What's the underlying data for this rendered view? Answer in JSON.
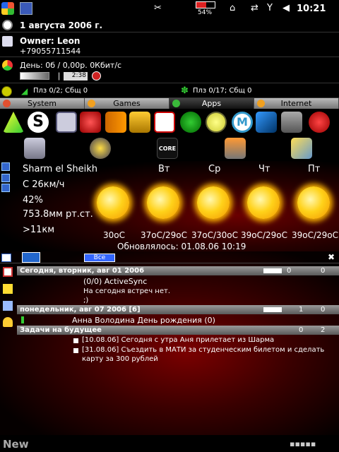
{
  "status": {
    "battery": "54%",
    "time": "10:21",
    "battery_level": 0.54
  },
  "date_row": {
    "text": "1 августа 2006 г."
  },
  "owner": {
    "name": "Owner: Leon",
    "phone": "+79055711544"
  },
  "traffic": {
    "text": "День: 0б / 0,00р. 0Кбит/с",
    "counter": "2:38"
  },
  "messages": {
    "left": "Плз 0/2; Сбщ 0",
    "right": "Плз 0/17; Сбщ 0"
  },
  "tabs": [
    {
      "label": "System",
      "dot": "#e05030"
    },
    {
      "label": "Games",
      "dot": "#f0a020"
    },
    {
      "label": "Apps",
      "dot": "#3aba3a"
    },
    {
      "label": "Internet",
      "dot": "#f0a020"
    }
  ],
  "apps_row2_label": "CORE",
  "weather": {
    "city": "Sharm el Sheikh",
    "wind": "С 26км/ч",
    "humidity": "42%",
    "pressure": "753.8мм рт.ст.",
    "visibility": ">11км",
    "days": [
      "Вт",
      "Ср",
      "Чт",
      "Пт"
    ],
    "temps": [
      "30oC",
      "37oC/29oC",
      "37oC/30oC",
      "39oC/29oC",
      "39oC/29oC"
    ],
    "updated": "Обновлялось: 01.08.06 10:19"
  },
  "agenda": {
    "filter": "Все",
    "today_header": "Сегодня, вторник, авг 01 2006",
    "today_counts": [
      "0",
      "0"
    ],
    "activesync": "(0/0) ActiveSync",
    "no_meetings": "На сегодня встреч нет.",
    "smiley": ";)",
    "monday_header": "понедельник, авг 07 2006 [6]",
    "monday_counts": [
      "1",
      "0"
    ],
    "birthday": "Анна Володина День рождения (0)",
    "future_header": "Задачи на будущее",
    "future_counts": [
      "0",
      "2"
    ],
    "tasks": [
      "[10.08.06] Сегодня с утра Аня прилетает из Шарма",
      "[31.08.06] Съездить в МАТИ за студенческим билетом и сделать",
      "карту за 300 рублей"
    ]
  },
  "bottom": {
    "new": "New"
  }
}
